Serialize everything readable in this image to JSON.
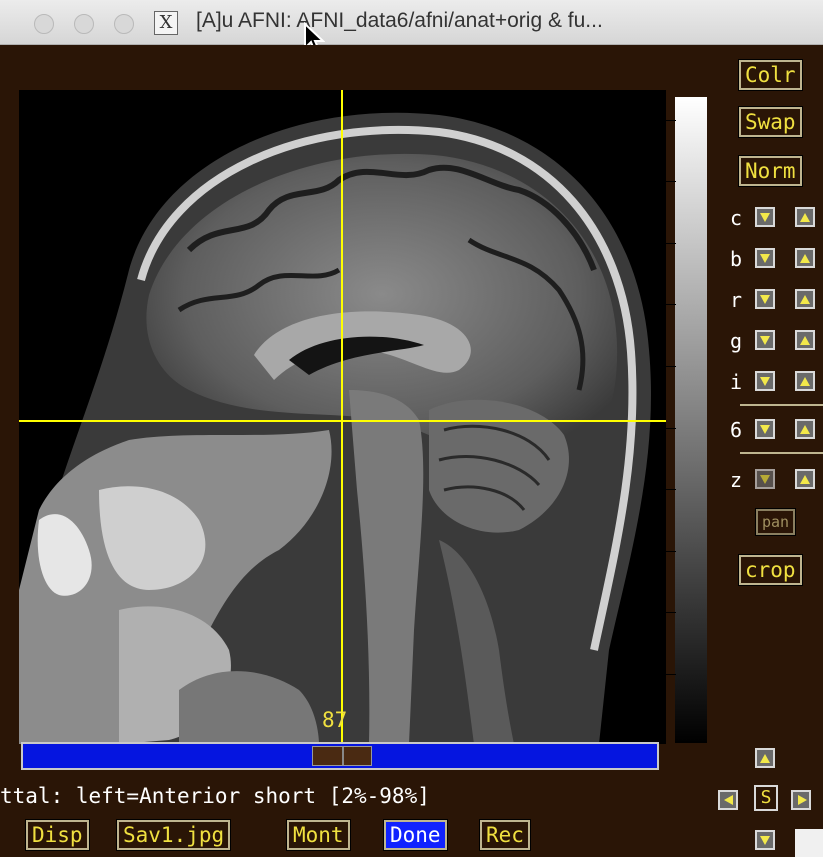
{
  "window": {
    "title": "[A]u AFNI: AFNI_data6/afni/anat+orig & fu..."
  },
  "colors": {
    "background": "#2a1506",
    "accent": "#f0e040",
    "slider": "#0515e0",
    "crosshair": "#ffff00"
  },
  "right_panel": {
    "buttons": {
      "colr": "Colr",
      "swap": "Swap",
      "norm": "Norm",
      "pan": "pan",
      "crop": "crop"
    },
    "controls": [
      {
        "label": "c"
      },
      {
        "label": "b"
      },
      {
        "label": "r"
      },
      {
        "label": "g"
      },
      {
        "label": "i"
      },
      {
        "label": "6"
      },
      {
        "label": "z"
      }
    ]
  },
  "slice": {
    "number": "87"
  },
  "info_line": "ttal: left=Anterior short [2%-98%]",
  "bottom_buttons": {
    "disp": "Disp",
    "save": "Sav1.jpg",
    "mont": "Mont",
    "done": "Done",
    "rec": "Rec"
  },
  "nav": {
    "center": "S"
  }
}
